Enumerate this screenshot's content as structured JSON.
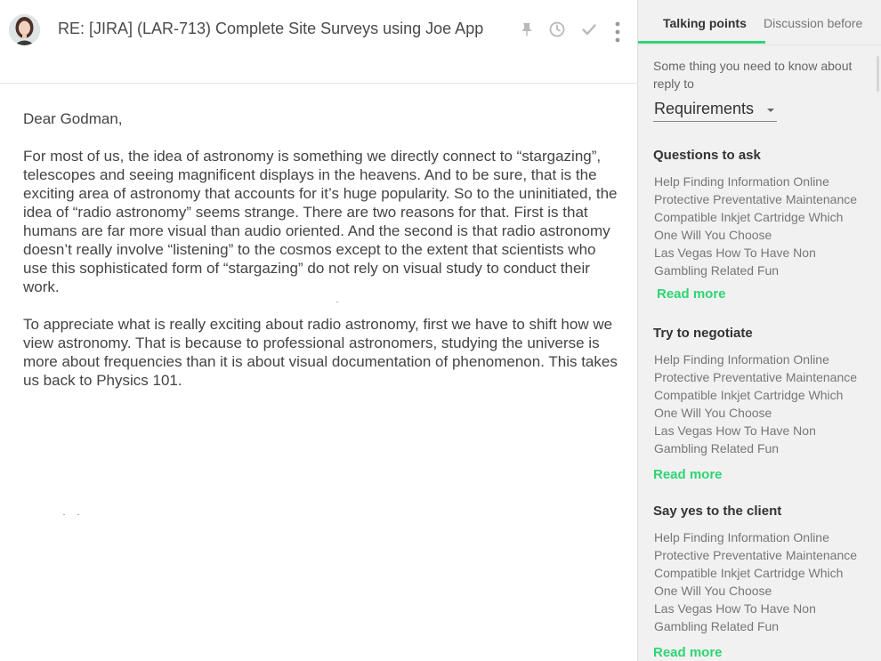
{
  "email": {
    "subject": "RE: [JIRA] (LAR-713) Complete Site Surveys using Joe App",
    "greeting": "Dear Godman,",
    "paragraphs": [
      "For most of us, the idea of astronomy is something we directly connect to “stargazing”, telescopes and seeing magnificent displays in the heavens. And to be sure, that is the exciting area of astronomy that accounts for it’s huge popularity. So to the uninitiated, the idea of “radio astronomy” seems strange. There are two reasons for that. First is that humans are far more visual than audio oriented. And the second is that radio astronomy doesn’t really involve “listening” to the cosmos except to the extent that scientists who use this sophisticated form of “stargazing” do not rely on visual study to conduct their work.",
      "To appreciate what is really exciting about radio astronomy, first we have to shift how we view astronomy. That is because to professional astronomers, studying the universe is more about frequencies than it is about visual documentation of phenomenon. This takes us back to Physics 101."
    ],
    "icons": [
      "pin-icon",
      "clock-icon",
      "check-icon",
      "more-vertical-icon"
    ]
  },
  "panel": {
    "tabs": [
      {
        "label": "Talking points",
        "active": true
      },
      {
        "label": "Discussion before",
        "active": false
      }
    ],
    "accent_color": "#2ed573",
    "intro": "Some thing you need to know about reply to",
    "dropdown": {
      "selected": "Requirements"
    },
    "sections": [
      {
        "title": "Questions to ask",
        "items": [
          "Help Finding Information Online",
          "Protective Preventative Maintenance",
          "Compatible Inkjet Cartridge Which One Will You Choose",
          "Las Vegas How To Have Non Gambling Related Fun"
        ],
        "read_more": "Read more"
      },
      {
        "title": "Try to negotiate",
        "items": [
          "Help Finding Information Online",
          "Protective Preventative Maintenance",
          "Compatible Inkjet Cartridge Which One Will You Choose",
          "Las Vegas How To Have Non Gambling Related Fun"
        ],
        "read_more": "Read more"
      },
      {
        "title": "Say yes to the client",
        "items": [
          "Help Finding Information Online",
          "Protective Preventative Maintenance",
          "Compatible Inkjet Cartridge Which One Will You Choose",
          "Las Vegas How To Have Non Gambling Related Fun"
        ],
        "read_more": "Read more"
      }
    ]
  }
}
